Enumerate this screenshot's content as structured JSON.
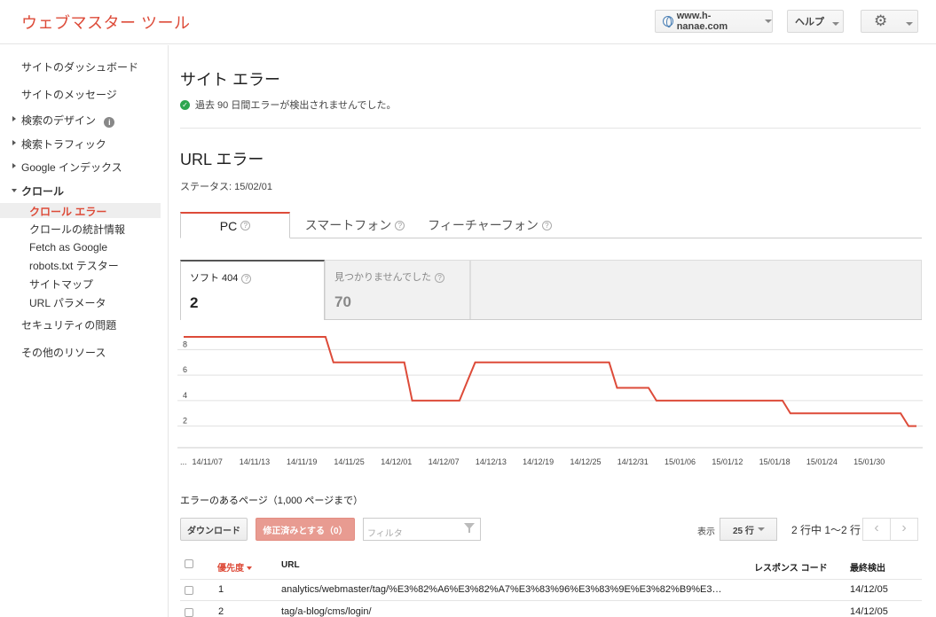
{
  "header": {
    "app_title": "ウェブマスター ツール",
    "site": "www.h-nanae.com",
    "help": "ヘルプ",
    "settings_icon": "gear-icon"
  },
  "sidebar": {
    "dashboard": "サイトのダッシュボード",
    "messages": "サイトのメッセージ",
    "search_appearance": "検索のデザイン",
    "search_traffic": "検索トラフィック",
    "google_index": "Google インデックス",
    "crawl": "クロール",
    "crawl_items": [
      "クロール エラー",
      "クロールの統計情報",
      "Fetch as Google",
      "robots.txt テスター",
      "サイトマップ",
      "URL パラメータ"
    ],
    "security": "セキュリティの問題",
    "other": "その他のリソース"
  },
  "site_errors": {
    "title": "サイト エラー",
    "message": "過去 90 日間エラーが検出されませんでした。"
  },
  "url_errors": {
    "title": "URL エラー",
    "status": "ステータス: 15/02/01"
  },
  "device_tabs": [
    "PC",
    "スマートフォン",
    "フィーチャーフォン"
  ],
  "count_tabs": [
    {
      "label": "ソフト 404",
      "value": "2"
    },
    {
      "label": "見つかりませんでした",
      "value": "70"
    }
  ],
  "chart_data": {
    "type": "line",
    "series_color": "#dd4b39",
    "ylim": [
      1,
      9
    ],
    "yticks": [
      2,
      4,
      6,
      8
    ],
    "grid": true,
    "x_tick_labels": [
      "...",
      "14/11/07",
      "14/11/13",
      "14/11/19",
      "14/11/25",
      "14/12/01",
      "14/12/07",
      "14/12/13",
      "14/12/19",
      "14/12/25",
      "14/12/31",
      "15/01/06",
      "15/01/12",
      "15/01/18",
      "15/01/24",
      "15/01/30"
    ],
    "x": [
      0,
      1,
      2,
      3,
      4,
      5,
      6,
      7,
      8,
      9,
      10,
      11,
      12,
      13,
      14,
      15,
      16,
      17,
      18,
      19,
      20,
      21,
      22,
      23,
      24,
      25,
      26,
      27,
      28,
      29,
      30,
      31,
      32,
      33,
      34,
      35,
      36,
      37,
      38,
      39,
      40,
      41,
      42,
      43,
      44,
      45,
      46,
      47,
      48,
      49,
      50,
      51,
      52,
      53,
      54,
      55,
      56,
      57,
      58,
      59,
      60,
      61,
      62,
      63,
      64,
      65,
      66,
      67,
      68,
      69,
      70,
      71,
      72,
      73,
      74,
      75,
      76,
      77,
      78,
      79,
      80,
      81,
      82,
      83,
      84,
      85,
      86,
      87,
      88,
      89,
      90,
      91,
      92,
      93
    ],
    "values": [
      9,
      9,
      9,
      9,
      9,
      9,
      9,
      9,
      9,
      9,
      9,
      9,
      9,
      9,
      9,
      9,
      9,
      9,
      9,
      7,
      7,
      7,
      7,
      7,
      7,
      7,
      7,
      7,
      7,
      4,
      4,
      4,
      4,
      4,
      4,
      4,
      5.5,
      7,
      7,
      7,
      7,
      7,
      7,
      7,
      7,
      7,
      7,
      7,
      7,
      7,
      7,
      7,
      7,
      7,
      7,
      5,
      5,
      5,
      5,
      5,
      4,
      4,
      4,
      4,
      4,
      4,
      4,
      4,
      4,
      4,
      4,
      4,
      4,
      4,
      4,
      4,
      4,
      3,
      3,
      3,
      3,
      3,
      3,
      3,
      3,
      3,
      3,
      3,
      3,
      3,
      3,
      3,
      2,
      2
    ]
  },
  "table": {
    "title": "エラーのあるページ（1,000 ページまで）",
    "download": "ダウンロード",
    "mark_fixed": "修正済みとする（0）",
    "filter_placeholder": "フィルタ",
    "show_label": "表示",
    "rows_per_page": "25 行",
    "range": "2 行中 1〜2 行",
    "headers": [
      "優先度",
      "URL",
      "レスポンス コード",
      "最終検出"
    ],
    "rows": [
      {
        "priority": "1",
        "url": "analytics/webmaster/tag/%E3%82%A6%E3%82%A7%E3%83%96%E3%83%9E%E3%82%B9%E3…",
        "code": "",
        "detected": "14/12/05"
      },
      {
        "priority": "2",
        "url": "tag/a-blog/cms/login/",
        "code": "",
        "detected": "14/12/05"
      }
    ]
  }
}
